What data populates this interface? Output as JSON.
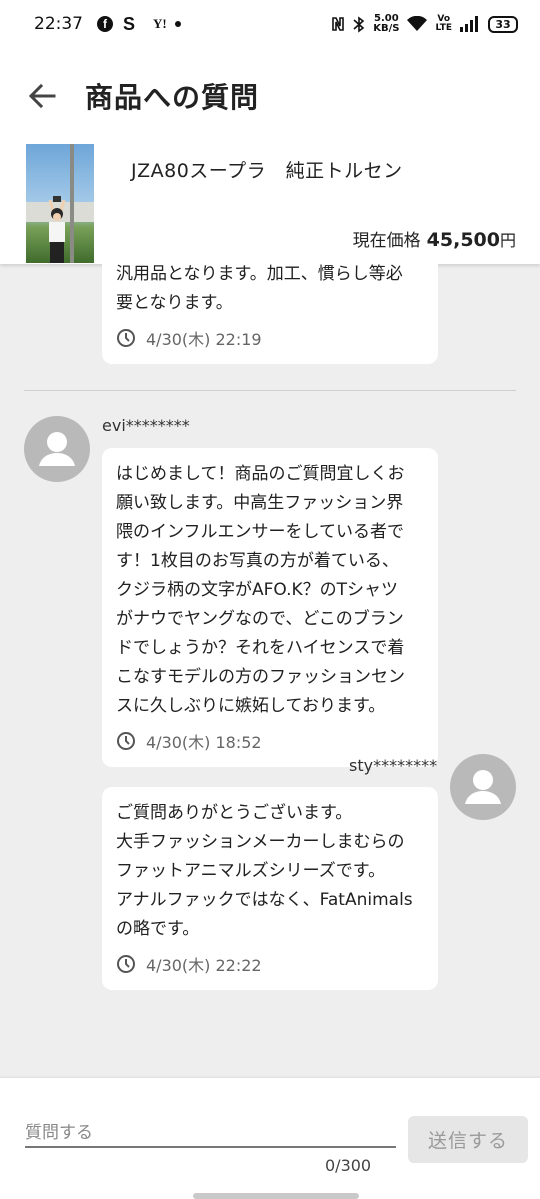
{
  "status_bar": {
    "time": "22:37",
    "app_s": "S",
    "app_y": "Y!",
    "speed_value": "5.00",
    "speed_unit": "KB/S",
    "volte_top": "Vo",
    "volte_bottom": "LTE",
    "battery": "33"
  },
  "header": {
    "title": "商品への質問"
  },
  "product": {
    "name": "JZA80スープラ　純正トルセン",
    "price_label": "現在価格",
    "price_value": "45,500",
    "price_unit": "円"
  },
  "messages": [
    {
      "text": "汎用品となります。加工、慣らし等必\n要となります。",
      "time": "4/30(木) 22:19"
    },
    {
      "user": "evi********",
      "text": "はじめまして！商品のご質問宜しくお\n願い致します。中高生ファッション界\n隈のインフルエンサーをしている者で\nす！1枚目のお写真の方が着ている、\nクジラ柄の文字がAFO.K？のTシャツ\nがナウでヤングなので、どこのブラン\nドでしょうか？それをハイセンスで着\nこなすモデルの方のファッションセン\nスに久しぶりに嫉妬しております。",
      "time": "4/30(木) 18:52"
    },
    {
      "user": "sty********",
      "text": "ご質問ありがとうございます。\n大手ファッションメーカーしまむらの\nファットアニマルズシリーズです。\nアナルファックではなく、FatAnimals\nの略です。",
      "time": "4/30(木) 22:22"
    }
  ],
  "composer": {
    "placeholder": "質問する",
    "counter": "0/300",
    "send_label": "送信する"
  },
  "colors": {
    "background": "#eeeeee",
    "bubble": "#ffffff",
    "avatar": "#b9b9b9",
    "send_disabled_bg": "#e6e6e6"
  }
}
